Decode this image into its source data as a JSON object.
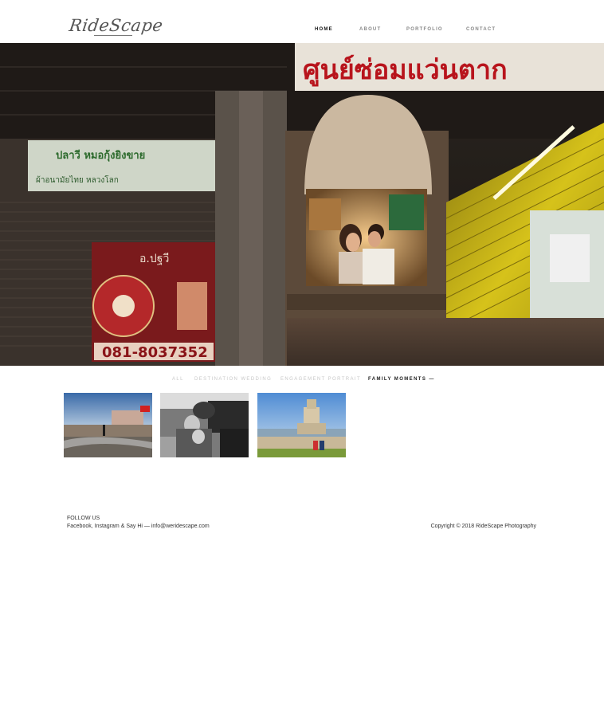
{
  "header": {
    "logo_text": "RideScape",
    "nav": {
      "home": "HOME",
      "about": "ABOUT",
      "portfolio": "PORTFOLIO",
      "contact": "CONTACT"
    },
    "active_nav": "HOME"
  },
  "hero": {
    "sign_top": "ศูนย์ซ่อมแว่นตาก",
    "banner_text_1": "ปลาวี หมอกุ้งยิงขาย",
    "banner_text_2": "ผ้าอนามัยไทย หลวงโลก",
    "sign_red_top": "อ.ปฐวี",
    "phone": "081-8037352"
  },
  "filters": {
    "all": "ALL",
    "destination_wedding": "DESTINATION WEDDING",
    "engagement_portrait": "ENGAGEMENT PORTRAIT",
    "family_moments": "FAMILY MOMENTS —",
    "active": "FAMILY MOMENTS"
  },
  "gallery": {
    "thumbnails": [
      "beach-scene",
      "bw-family-in-vehicle",
      "couple-by-tower"
    ]
  },
  "footer": {
    "follow_title": "FOLLOW US",
    "links_text": "Facebook, Instagram & Say Hi — info@weridescape.com",
    "copyright": "Copyright © 2018 RideScape Photography"
  }
}
